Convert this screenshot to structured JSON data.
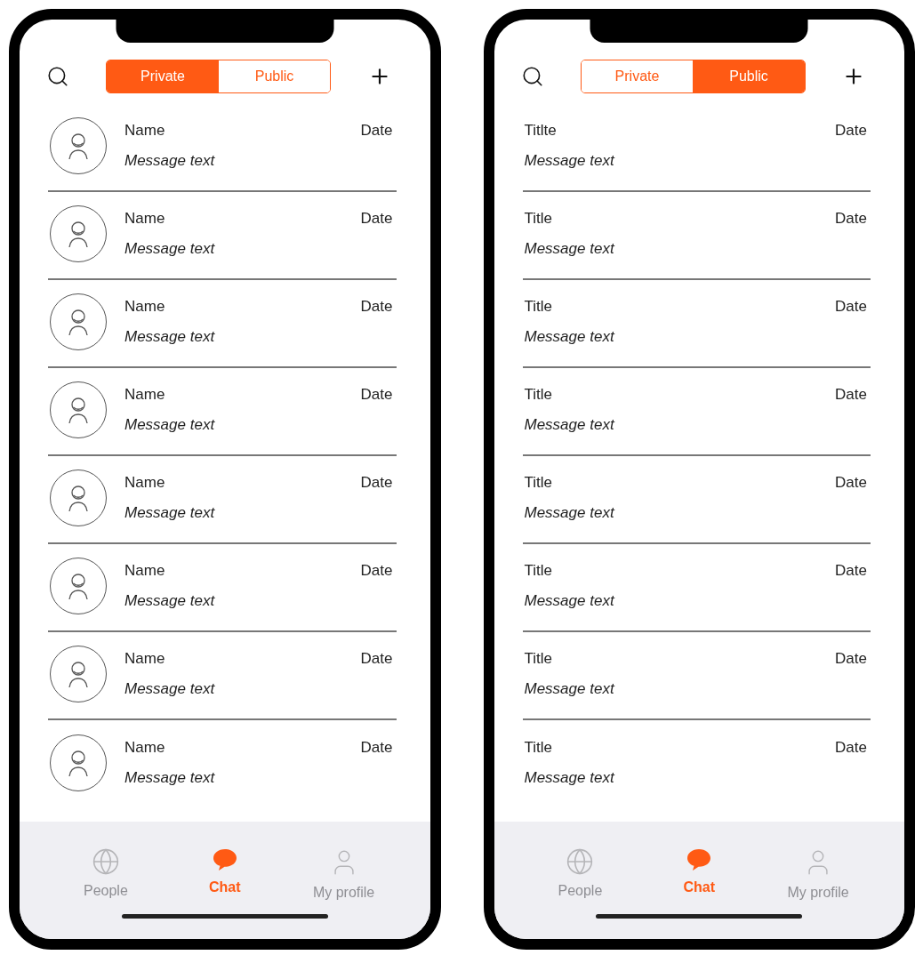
{
  "phones": [
    {
      "tabs": [
        {
          "label": "Private",
          "selected": true
        },
        {
          "label": "Public",
          "selected": false
        }
      ],
      "rows": [
        {
          "kind": "contact",
          "title": "Name",
          "date": "Date",
          "message": "Message text"
        },
        {
          "kind": "contact",
          "title": "Name",
          "date": "Date",
          "message": "Message text"
        },
        {
          "kind": "contact",
          "title": "Name",
          "date": "Date",
          "message": "Message text"
        },
        {
          "kind": "contact",
          "title": "Name",
          "date": "Date",
          "message": "Message text"
        },
        {
          "kind": "contact",
          "title": "Name",
          "date": "Date",
          "message": "Message text"
        },
        {
          "kind": "contact",
          "title": "Name",
          "date": "Date",
          "message": "Message text"
        },
        {
          "kind": "contact",
          "title": "Name",
          "date": "Date",
          "message": "Message text"
        },
        {
          "kind": "contact",
          "title": "Name",
          "date": "Date",
          "message": "Message text"
        }
      ],
      "nav": [
        {
          "kind": "globe",
          "label": "People",
          "selected": false
        },
        {
          "kind": "chat",
          "label": "Chat",
          "selected": true
        },
        {
          "kind": "person",
          "label": "My profile",
          "selected": false
        }
      ]
    },
    {
      "tabs": [
        {
          "label": "Private",
          "selected": false
        },
        {
          "label": "Public",
          "selected": true
        }
      ],
      "rows": [
        {
          "kind": "post",
          "title": "Titlte",
          "date": "Date",
          "message": "Message text"
        },
        {
          "kind": "post",
          "title": "Title",
          "date": "Date",
          "message": "Message text"
        },
        {
          "kind": "post",
          "title": "Title",
          "date": "Date",
          "message": "Message text"
        },
        {
          "kind": "post",
          "title": "Title",
          "date": "Date",
          "message": "Message text"
        },
        {
          "kind": "post",
          "title": "Title",
          "date": "Date",
          "message": "Message text"
        },
        {
          "kind": "post",
          "title": "Title",
          "date": "Date",
          "message": "Message text"
        },
        {
          "kind": "post",
          "title": "Title",
          "date": "Date",
          "message": "Message text"
        },
        {
          "kind": "post",
          "title": "Title",
          "date": "Date",
          "message": "Message text"
        }
      ],
      "nav": [
        {
          "kind": "globe",
          "label": "People",
          "selected": false
        },
        {
          "kind": "chat",
          "label": "Chat",
          "selected": true
        },
        {
          "kind": "person",
          "label": "My profile",
          "selected": false
        }
      ]
    }
  ]
}
